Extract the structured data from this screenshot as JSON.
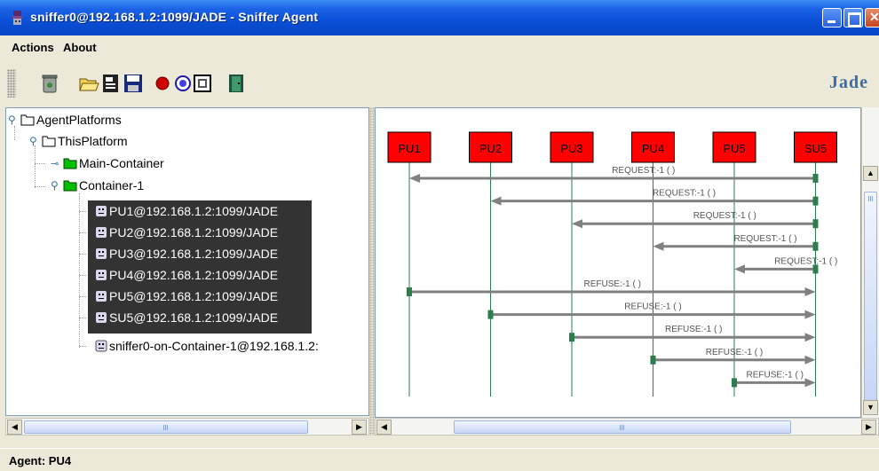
{
  "window": {
    "title": "sniffer0@192.168.1.2:1099/JADE - Sniffer Agent"
  },
  "menu": {
    "items": [
      "Actions",
      "About"
    ]
  },
  "toolbar": {
    "tools": [
      "trash-icon",
      "open-folder-icon",
      "open-file-icon",
      "save-icon",
      "record-icon",
      "sniff-icon",
      "snapshot-icon",
      "exit-door-icon"
    ],
    "logo_text": "Jade"
  },
  "tree": {
    "root": "AgentPlatforms",
    "platform": "ThisPlatform",
    "main_container": "Main-Container",
    "container": "Container-1",
    "agents": [
      "PU1@192.168.1.2:1099/JADE",
      "PU2@192.168.1.2:1099/JADE",
      "PU3@192.168.1.2:1099/JADE",
      "PU4@192.168.1.2:1099/JADE",
      "PU5@192.168.1.2:1099/JADE",
      "SU5@192.168.1.2:1099/JADE"
    ],
    "sniffer_agent": "sniffer0-on-Container-1@192.168.1.2:"
  },
  "sniffer": {
    "agents": [
      "PU1",
      "PU2",
      "PU3",
      "PU4",
      "PU5",
      "SU5"
    ],
    "agent_color": "#ff0000",
    "line_color": "#2e7d4f",
    "arrow_color": "#808080",
    "messages": [
      {
        "from": "SU5",
        "to": "PU1",
        "label": "REQUEST:-1 (     )"
      },
      {
        "from": "SU5",
        "to": "PU2",
        "label": "REQUEST:-1 (     )"
      },
      {
        "from": "SU5",
        "to": "PU3",
        "label": "REQUEST:-1 (     )"
      },
      {
        "from": "SU5",
        "to": "PU4",
        "label": "REQUEST:-1 (     )"
      },
      {
        "from": "SU5",
        "to": "PU5",
        "label": "REQUEST:-1 (     )"
      },
      {
        "from": "PU1",
        "to": "SU5",
        "label": "REFUSE:-1 (     )"
      },
      {
        "from": "PU2",
        "to": "SU5",
        "label": "REFUSE:-1 (     )"
      },
      {
        "from": "PU3",
        "to": "SU5",
        "label": "REFUSE:-1 (     )"
      },
      {
        "from": "PU4",
        "to": "SU5",
        "label": "REFUSE:-1 (     )"
      },
      {
        "from": "PU5",
        "to": "SU5",
        "label": "REFUSE:-1 (     )"
      }
    ]
  },
  "status": {
    "text": "Agent: PU4"
  }
}
